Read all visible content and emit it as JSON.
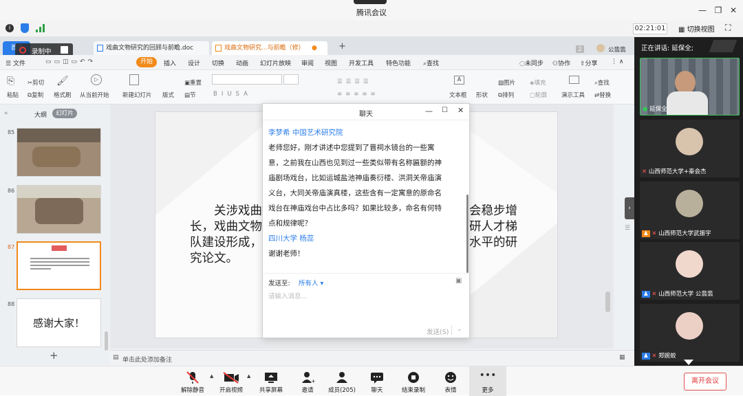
{
  "window": {
    "title": "腾讯会议"
  },
  "meeting_bar": {
    "timer": "02:21:01",
    "switch_view": "切换视图"
  },
  "recording": {
    "label": "录制中"
  },
  "wps_tabs": [
    {
      "label": "首页"
    },
    {
      "label": "戏曲文物研究的回顾与前瞻.doc"
    },
    {
      "label": "戏曲文物研究...与前瞻（修）"
    }
  ],
  "wps_right": {
    "badge": "2",
    "user": "公翡翡"
  },
  "menu": {
    "file": "文件",
    "start": "开始",
    "items": [
      "插入",
      "设计",
      "切换",
      "动画",
      "幻灯片放映",
      "审阅",
      "视图",
      "开发工具",
      "特色功能"
    ],
    "search": "查找",
    "sync": "未同步",
    "collab": "协作",
    "share": "分享"
  },
  "ribbon": {
    "paste": "粘贴",
    "cut": "剪切",
    "copy": "复制",
    "format_painter": "格式刷",
    "from_current": "从当前开始",
    "new_slide": "新建幻灯片",
    "layout": "版式",
    "reset": "重置",
    "section": "节",
    "textbox": "文本框",
    "shape": "形状",
    "arrange": "排列",
    "picture": "图片",
    "fill": "填充",
    "outline": "轮廓",
    "present_tools": "演示工具",
    "find": "查找",
    "replace": "替换"
  },
  "panel": {
    "outline": "大纲",
    "slides": "幻灯片",
    "slide_nums": [
      "85",
      "86",
      "87",
      "88"
    ],
    "slide88_text": "感谢大家！",
    "add": "+"
  },
  "slide": {
    "lines": [
      "关涉戏曲",
      "长，戏曲文物",
      "队建设形成，",
      "究论文。"
    ],
    "right_lines": [
      "会稳步增",
      "研人才梯",
      "水平的研"
    ]
  },
  "notes": {
    "placeholder": "单击此处添加备注"
  },
  "chat": {
    "title": "聊天",
    "messages": [
      {
        "sender": "李梦希 中国艺术研究院",
        "lines": [
          "老师您好，刚才讲述中您提到了晋祠水镜台的一些寓",
          "意，之前我在山西也见到过一些类似带有名称匾额的神",
          "庙剧场戏台，比如运城盐池神庙奏衍楼、洪洞关帝庙演",
          "义台，大同关帝庙演真楼，这些含有一定寓意的原命名",
          "戏台在神庙戏台中占比多吗？如果比较多，命名有何特",
          "点和规律呢？"
        ]
      },
      {
        "sender": "四川大学  杨蕊",
        "lines": [
          "谢谢老师！"
        ]
      }
    ],
    "send_to_label": "发送至:",
    "send_to_value": "所有人",
    "input_placeholder": "请输入消息...",
    "send": "发送(S)"
  },
  "video": {
    "speaking_label": "正在讲话: 延保全;",
    "tiles": [
      {
        "name": "延保全"
      },
      {
        "name": "山西师范大学+秦会杰"
      },
      {
        "name": "山西师范大学武振宇"
      },
      {
        "name": "山西师范大学 公翡翡"
      },
      {
        "name": "郑婉蛟"
      }
    ]
  },
  "toolbar": {
    "buttons": [
      "解除静音",
      "开启视频",
      "共享屏幕",
      "邀请",
      "成员(205)",
      "聊天",
      "结束录制",
      "表情",
      "更多"
    ],
    "leave": "离开会议"
  },
  "colors": {
    "accent": "#2b7de9",
    "wps_orange": "#f28a1a",
    "leave_red": "#e03c3c",
    "video_bg": "#1e1e1e"
  }
}
